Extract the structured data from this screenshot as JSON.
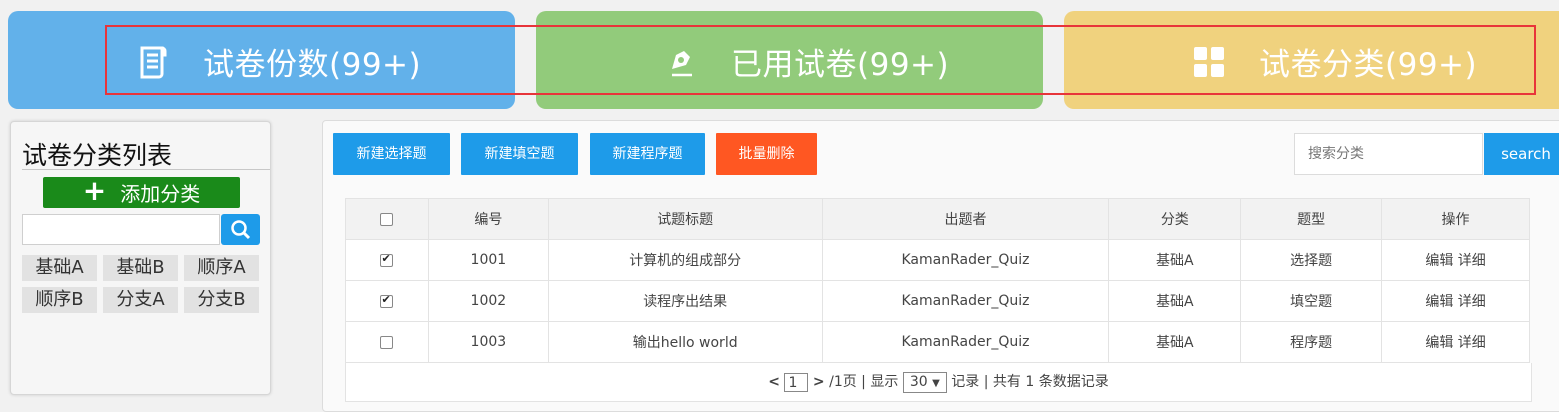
{
  "stat_cards": [
    {
      "label": "试卷份数(99+)",
      "icon": "document-icon",
      "color": "#62b1ea"
    },
    {
      "label": "已用试卷(99+)",
      "icon": "pen-icon",
      "color": "#92cb7b"
    },
    {
      "label": "试卷分类(99+)",
      "icon": "grid-icon",
      "color": "#f0d27e"
    }
  ],
  "sidebar": {
    "title": "试卷分类列表",
    "add_button": "添加分类",
    "tags": [
      "基础A",
      "基础B",
      "顺序A",
      "顺序B",
      "分支A",
      "分支B"
    ]
  },
  "toolbar": {
    "new_choice": "新建选择题",
    "new_fill": "新建填空题",
    "new_program": "新建程序题",
    "batch_delete": "批量删除",
    "search_placeholder": "搜索分类",
    "search_button": "search"
  },
  "table": {
    "headers": [
      "编号",
      "试题标题",
      "出题者",
      "分类",
      "题型",
      "操作"
    ],
    "rows": [
      {
        "checked": true,
        "id": "1001",
        "title": "计算机的组成部分",
        "author": "KamanRader_Quiz",
        "category": "基础A",
        "type": "选择题",
        "edit": "编辑",
        "detail": "详细"
      },
      {
        "checked": true,
        "id": "1002",
        "title": "读程序出结果",
        "author": "KamanRader_Quiz",
        "category": "基础A",
        "type": "填空题",
        "edit": "编辑",
        "detail": "详细"
      },
      {
        "checked": false,
        "id": "1003",
        "title": "输出hello world",
        "author": "KamanRader_Quiz",
        "category": "基础A",
        "type": "程序题",
        "edit": "编辑",
        "detail": "详细"
      }
    ]
  },
  "pager": {
    "prev": "<",
    "page": "1",
    "next": ">",
    "total_pages": "/1页",
    "show_label": "显示",
    "page_size": "30",
    "records_label": "记录",
    "summary": "共有 1 条数据记录"
  },
  "colors": {
    "blue": "#1e9be9",
    "orange": "#ff5722",
    "green": "#1a8a1a",
    "highlight": "#e8343a"
  }
}
